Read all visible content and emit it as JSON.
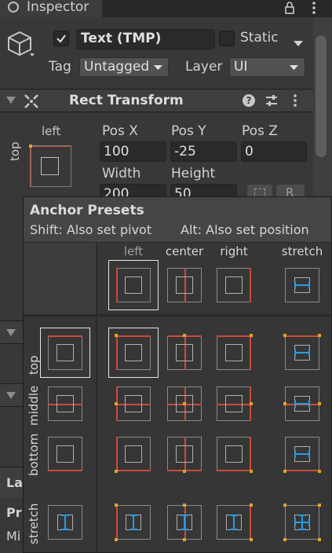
{
  "tab": {
    "title": "Inspector"
  },
  "object": {
    "name": "Text (TMP)",
    "static_label": "Static",
    "tag_label": "Tag",
    "tag_value": "Untagged",
    "layer_label": "Layer",
    "layer_value": "UI"
  },
  "rect_transform": {
    "title": "Rect Transform",
    "anchor_h": "left",
    "anchor_v": "top",
    "pos_x_label": "Pos X",
    "pos_y_label": "Pos Y",
    "pos_z_label": "Pos Z",
    "pos_x": "100",
    "pos_y": "-25",
    "pos_z": "0",
    "width_label": "Width",
    "height_label": "Height",
    "width": "200",
    "height": "50",
    "blueprint_btn": "R"
  },
  "popup": {
    "title": "Anchor Presets",
    "shift_hint": "Shift: Also set pivot",
    "alt_hint": "Alt: Also set position",
    "columns": [
      "left",
      "center",
      "right",
      "stretch"
    ],
    "rows": [
      "top",
      "middle",
      "bottom",
      "stretch"
    ]
  },
  "behind": {
    "la": "La",
    "pr": "Pr",
    "mi": "Mi"
  },
  "colors": {
    "anchor_red": "#cc4b3c",
    "pivot_yellow": "#e5a520",
    "stretch_blue": "#2c9be0"
  }
}
